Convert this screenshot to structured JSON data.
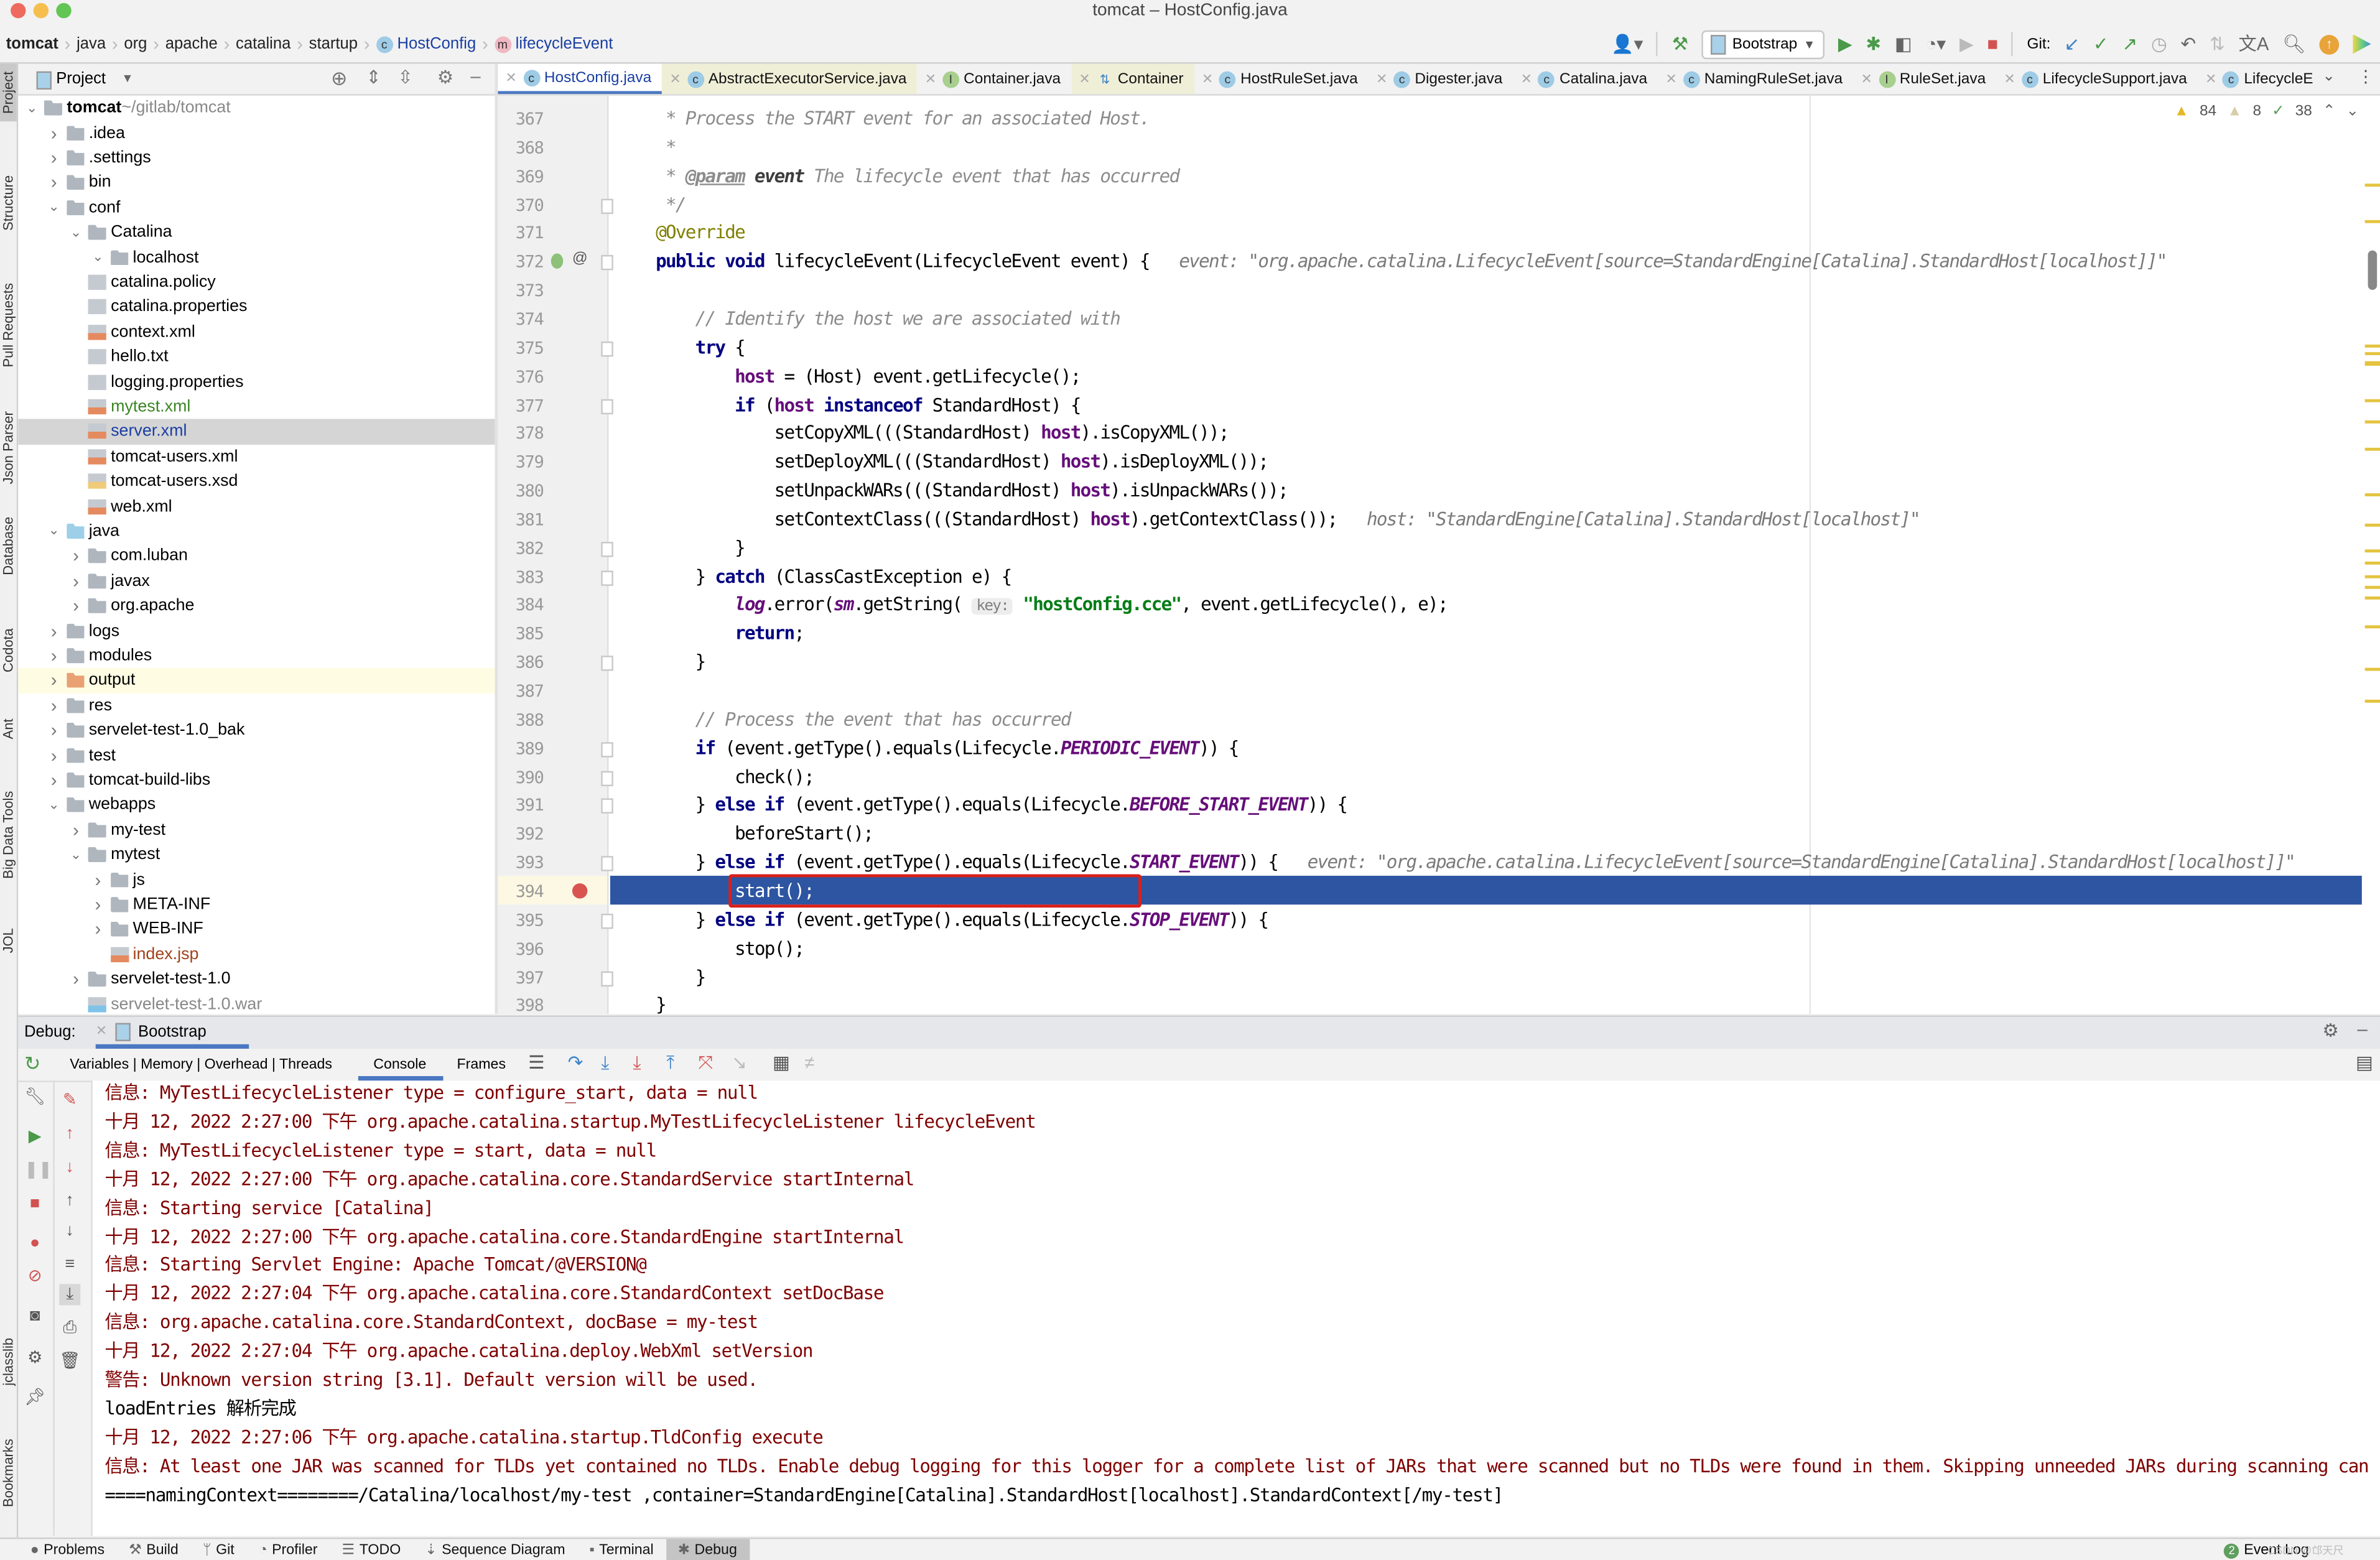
{
  "window": {
    "title": "tomcat – HostConfig.java",
    "traffic_lights": [
      "#ee6a5f",
      "#f5be4f",
      "#62c554"
    ]
  },
  "breadcrumb": [
    {
      "label": "tomcat",
      "bold": true
    },
    {
      "label": "java"
    },
    {
      "label": "org"
    },
    {
      "label": "apache"
    },
    {
      "label": "catalina"
    },
    {
      "label": "startup"
    },
    {
      "label": "HostConfig",
      "icon": "class-icon",
      "badge": "c",
      "badge_color": "#9ecbe5",
      "color": "#1a3fa3"
    },
    {
      "label": "lifecycleEvent",
      "icon": "method-icon",
      "badge": "m",
      "badge_color": "#f0b8c2",
      "color": "#1a3fa3"
    }
  ],
  "toolbar": {
    "run_config": "Bootstrap",
    "git_label": "Git:",
    "icons": [
      "user-icon",
      "build-hammer-icon",
      "run-icon",
      "debug-icon",
      "coverage-icon",
      "profile-icon",
      "stop-icon",
      "git-update-icon",
      "git-commit-icon",
      "git-push-icon",
      "history-icon",
      "rollback-icon",
      "translate-icon",
      "search-icon",
      "update-icon",
      "plugin-icon"
    ]
  },
  "project_panel": {
    "title": "Project",
    "tree": [
      {
        "label": "tomcat",
        "suffix": " ~/gitlab/tomcat",
        "level": 0,
        "expanded": true,
        "icon": "folder",
        "bold": true
      },
      {
        "label": ".idea",
        "level": 1,
        "expanded": false,
        "icon": "folder"
      },
      {
        "label": ".settings",
        "level": 1,
        "expanded": false,
        "icon": "folder"
      },
      {
        "label": "bin",
        "level": 1,
        "expanded": false,
        "icon": "folder"
      },
      {
        "label": "conf",
        "level": 1,
        "expanded": true,
        "icon": "folder"
      },
      {
        "label": "Catalina",
        "level": 2,
        "expanded": true,
        "icon": "folder"
      },
      {
        "label": "localhost",
        "level": 3,
        "expanded": true,
        "icon": "folder"
      },
      {
        "label": "catalina.policy",
        "level": 2,
        "icon": "file"
      },
      {
        "label": "catalina.properties",
        "level": 2,
        "icon": "properties"
      },
      {
        "label": "context.xml",
        "level": 2,
        "icon": "xml"
      },
      {
        "label": "hello.txt",
        "level": 2,
        "icon": "file"
      },
      {
        "label": "logging.properties",
        "level": 2,
        "icon": "properties"
      },
      {
        "label": "mytest.xml",
        "level": 2,
        "icon": "xml",
        "color": "#3b8524"
      },
      {
        "label": "server.xml",
        "level": 2,
        "icon": "xml",
        "color": "#1a3fa3",
        "selected": true
      },
      {
        "label": "tomcat-users.xml",
        "level": 2,
        "icon": "xml"
      },
      {
        "label": "tomcat-users.xsd",
        "level": 2,
        "icon": "xsd"
      },
      {
        "label": "web.xml",
        "level": 2,
        "icon": "xml"
      },
      {
        "label": "java",
        "level": 1,
        "expanded": true,
        "icon": "source-folder"
      },
      {
        "label": "com.luban",
        "level": 2,
        "expanded": false,
        "icon": "package"
      },
      {
        "label": "javax",
        "level": 2,
        "expanded": false,
        "icon": "package"
      },
      {
        "label": "org.apache",
        "level": 2,
        "expanded": false,
        "icon": "package"
      },
      {
        "label": "logs",
        "level": 1,
        "expanded": false,
        "icon": "folder"
      },
      {
        "label": "modules",
        "level": 1,
        "expanded": false,
        "icon": "folder"
      },
      {
        "label": "output",
        "level": 1,
        "expanded": false,
        "icon": "excluded-folder",
        "highlight": true
      },
      {
        "label": "res",
        "level": 1,
        "expanded": false,
        "icon": "folder"
      },
      {
        "label": "servelet-test-1.0_bak",
        "level": 1,
        "expanded": false,
        "icon": "folder"
      },
      {
        "label": "test",
        "level": 1,
        "expanded": false,
        "icon": "folder"
      },
      {
        "label": "tomcat-build-libs",
        "level": 1,
        "expanded": false,
        "icon": "folder"
      },
      {
        "label": "webapps",
        "level": 1,
        "expanded": true,
        "icon": "folder"
      },
      {
        "label": "my-test",
        "level": 2,
        "expanded": false,
        "icon": "folder"
      },
      {
        "label": "mytest",
        "level": 2,
        "expanded": true,
        "icon": "folder"
      },
      {
        "label": "js",
        "level": 3,
        "expanded": false,
        "icon": "folder"
      },
      {
        "label": "META-INF",
        "level": 3,
        "expanded": false,
        "icon": "folder"
      },
      {
        "label": "WEB-INF",
        "level": 3,
        "expanded": false,
        "icon": "folder"
      },
      {
        "label": "index.jsp",
        "level": 3,
        "icon": "jsp",
        "color": "#a0421a"
      },
      {
        "label": "servelet-test-1.0",
        "level": 2,
        "expanded": false,
        "icon": "folder"
      },
      {
        "label": "servelet-test-1.0.war",
        "level": 2,
        "icon": "archive",
        "color": "#888888"
      }
    ]
  },
  "left_tool_strip": [
    "Project",
    "Structure",
    "Pull Requests",
    "Json Parser",
    "Database",
    "Codota",
    "Ant",
    "Big Data Tools",
    "JOL",
    "jclasslib",
    "Bookmarks"
  ],
  "editor_tabs": [
    {
      "label": "HostConfig.java",
      "badge": "c",
      "active": true
    },
    {
      "label": "AbstractExecutorService.java",
      "badge": "c",
      "tint": true
    },
    {
      "label": "Container.java",
      "badge": "I"
    },
    {
      "label": "Container",
      "badge": "⇅",
      "tint": true
    },
    {
      "label": "HostRuleSet.java",
      "badge": "c"
    },
    {
      "label": "Digester.java",
      "badge": "c"
    },
    {
      "label": "Catalina.java",
      "badge": "c"
    },
    {
      "label": "NamingRuleSet.java",
      "badge": "c"
    },
    {
      "label": "RuleSet.java",
      "badge": "I"
    },
    {
      "label": "LifecycleSupport.java",
      "badge": "c"
    },
    {
      "label": "LifecycleE",
      "badge": "c"
    }
  ],
  "inspections": {
    "warnings": "84",
    "weak_warnings": "8",
    "typos": "38"
  },
  "editor": {
    "current_line": 394,
    "lines": [
      {
        "n": 367,
        "t": [
          [
            " * Process the START event for an associated Host.",
            "d"
          ]
        ]
      },
      {
        "n": 368,
        "t": [
          [
            " *",
            "d"
          ]
        ]
      },
      {
        "n": 369,
        "t": [
          [
            " * ",
            "d"
          ],
          [
            "@param",
            "dt"
          ],
          [
            " event",
            "db"
          ],
          [
            " The lifecycle event that has occurred",
            "d"
          ]
        ]
      },
      {
        "n": 370,
        "t": [
          [
            " */",
            "d"
          ]
        ]
      },
      {
        "n": 371,
        "t": [
          [
            "@Override",
            "an"
          ]
        ]
      },
      {
        "n": 372,
        "t": [
          [
            "public void",
            "k"
          ],
          [
            " lifecycleEvent(LifecycleEvent event) {",
            ""
          ],
          [
            "   event: \"org.apache.catalina.LifecycleEvent[source=StandardEngine[Catalina].StandardHost[localhost]]\"",
            "h"
          ]
        ]
      },
      {
        "n": 373,
        "t": []
      },
      {
        "n": 374,
        "t": [
          [
            "    // Identify the host we are associated with",
            "c"
          ]
        ]
      },
      {
        "n": 375,
        "t": [
          [
            "    ",
            ""
          ],
          [
            "try",
            "k"
          ],
          [
            " {",
            ""
          ]
        ]
      },
      {
        "n": 376,
        "t": [
          [
            "        ",
            ""
          ],
          [
            "host",
            "f"
          ],
          [
            " = (Host) event.getLifecycle();",
            ""
          ]
        ]
      },
      {
        "n": 377,
        "t": [
          [
            "        ",
            ""
          ],
          [
            "if",
            "k"
          ],
          [
            " (",
            ""
          ],
          [
            "host",
            "f"
          ],
          [
            " ",
            ""
          ],
          [
            "instanceof",
            "k"
          ],
          [
            " StandardHost) {",
            ""
          ]
        ]
      },
      {
        "n": 378,
        "t": [
          [
            "            setCopyXML(((StandardHost) ",
            ""
          ],
          [
            "host",
            "f"
          ],
          [
            ").isCopyXML());",
            ""
          ]
        ]
      },
      {
        "n": 379,
        "t": [
          [
            "            setDeployXML(((StandardHost) ",
            ""
          ],
          [
            "host",
            "f"
          ],
          [
            ").isDeployXML());",
            ""
          ]
        ]
      },
      {
        "n": 380,
        "t": [
          [
            "            setUnpackWARs(((StandardHost) ",
            ""
          ],
          [
            "host",
            "f"
          ],
          [
            ").isUnpackWARs());",
            ""
          ]
        ]
      },
      {
        "n": 381,
        "t": [
          [
            "            setContextClass(((StandardHost) ",
            ""
          ],
          [
            "host",
            "f"
          ],
          [
            ").getContextClass());",
            ""
          ],
          [
            "   host: \"StandardEngine[Catalina].StandardHost[localhost]\"",
            "h"
          ]
        ]
      },
      {
        "n": 382,
        "t": [
          [
            "        }",
            ""
          ]
        ]
      },
      {
        "n": 383,
        "t": [
          [
            "    } ",
            ""
          ],
          [
            "catch",
            "k"
          ],
          [
            " (ClassCastException e) {",
            ""
          ]
        ]
      },
      {
        "n": 384,
        "t": [
          [
            "        ",
            ""
          ],
          [
            "log",
            "lg"
          ],
          [
            ".error(",
            ""
          ],
          [
            "sm",
            "lg"
          ],
          [
            ".getString( ",
            ""
          ],
          [
            "key:",
            "p"
          ],
          [
            " ",
            ""
          ],
          [
            "\"hostConfig.cce\"",
            "s"
          ],
          [
            ", event.getLifecycle(), e);",
            ""
          ]
        ]
      },
      {
        "n": 385,
        "t": [
          [
            "        ",
            ""
          ],
          [
            "return",
            "k"
          ],
          [
            ";",
            ""
          ]
        ]
      },
      {
        "n": 386,
        "t": [
          [
            "    }",
            ""
          ]
        ]
      },
      {
        "n": 387,
        "t": []
      },
      {
        "n": 388,
        "t": [
          [
            "    // Process the event that has occurred",
            "c"
          ]
        ]
      },
      {
        "n": 389,
        "t": [
          [
            "    ",
            ""
          ],
          [
            "if",
            "k"
          ],
          [
            " (event.getType().equals(Lifecycle.",
            ""
          ],
          [
            "PERIODIC_EVENT",
            "st"
          ],
          [
            ")) {",
            ""
          ]
        ]
      },
      {
        "n": 390,
        "t": [
          [
            "        check();",
            ""
          ]
        ]
      },
      {
        "n": 391,
        "t": [
          [
            "    } ",
            ""
          ],
          [
            "else if",
            "k"
          ],
          [
            " (event.getType().equals(Lifecycle.",
            ""
          ],
          [
            "BEFORE_START_EVENT",
            "st"
          ],
          [
            ")) {",
            ""
          ]
        ]
      },
      {
        "n": 392,
        "t": [
          [
            "        beforeStart();",
            ""
          ]
        ]
      },
      {
        "n": 393,
        "t": [
          [
            "    } ",
            ""
          ],
          [
            "else if",
            "k"
          ],
          [
            " (event.getType().equals(Lifecycle.",
            ""
          ],
          [
            "START_EVENT",
            "st"
          ],
          [
            ")) {",
            ""
          ],
          [
            "   event: \"org.apache.catalina.LifecycleEvent[source=StandardEngine[Catalina].StandardHost[localhost]]\"",
            "h"
          ]
        ]
      },
      {
        "n": 394,
        "t": [
          [
            "        start();",
            ""
          ]
        ]
      },
      {
        "n": 395,
        "t": [
          [
            "    } ",
            ""
          ],
          [
            "else if",
            "k"
          ],
          [
            " (event.getType().equals(Lifecycle.",
            ""
          ],
          [
            "STOP_EVENT",
            "st"
          ],
          [
            ")) {",
            ""
          ]
        ]
      },
      {
        "n": 396,
        "t": [
          [
            "        stop();",
            ""
          ]
        ]
      },
      {
        "n": 397,
        "t": [
          [
            "    }",
            ""
          ]
        ]
      },
      {
        "n": 398,
        "t": [
          [
            "}",
            ""
          ]
        ]
      }
    ]
  },
  "debug": {
    "label": "Debug:",
    "session": "Bootstrap",
    "tabs": {
      "variables_group": "Variables | Memory | Overhead | Threads",
      "console": "Console",
      "frames": "Frames"
    },
    "active_tab": "Console",
    "console_lines": [
      {
        "text": "信息: MyTestLifecycleListener type = configure_start, data = null",
        "color": "#7f0000"
      },
      {
        "text": "十月 12, 2022 2:27:00 下午 org.apache.catalina.startup.MyTestLifecycleListener lifecycleEvent",
        "color": "#7f0000"
      },
      {
        "text": "信息: MyTestLifecycleListener type = start, data = null",
        "color": "#7f0000"
      },
      {
        "text": "十月 12, 2022 2:27:00 下午 org.apache.catalina.core.StandardService startInternal",
        "color": "#7f0000"
      },
      {
        "text": "信息: Starting service [Catalina]",
        "color": "#7f0000"
      },
      {
        "text": "十月 12, 2022 2:27:00 下午 org.apache.catalina.core.StandardEngine startInternal",
        "color": "#7f0000"
      },
      {
        "text": "信息: Starting Servlet Engine: Apache Tomcat/@VERSION@",
        "color": "#7f0000"
      },
      {
        "text": "十月 12, 2022 2:27:04 下午 org.apache.catalina.core.StandardContext setDocBase",
        "color": "#7f0000"
      },
      {
        "text": "信息: org.apache.catalina.core.StandardContext, docBase = my-test",
        "color": "#7f0000"
      },
      {
        "text": "十月 12, 2022 2:27:04 下午 org.apache.catalina.deploy.WebXml setVersion",
        "color": "#7f0000"
      },
      {
        "text": "警告: Unknown version string [3.1]. Default version will be used.",
        "color": "#7f0000"
      },
      {
        "text": "loadEntries 解析完成",
        "color": "#000000"
      },
      {
        "text": "十月 12, 2022 2:27:06 下午 org.apache.catalina.startup.TldConfig execute",
        "color": "#7f0000"
      },
      {
        "text": "信息: At least one JAR was scanned for TLDs yet contained no TLDs. Enable debug logging for this logger for a complete list of JARs that were scanned but no TLDs were found in them. Skipping unneeded JARs during scanning can impr",
        "color": "#7f0000"
      },
      {
        "text": "====namingContext========/Catalina/localhost/my-test ,container=StandardEngine[Catalina].StandardHost[localhost].StandardContext[/my-test]",
        "color": "#000000"
      }
    ]
  },
  "status_bar": {
    "items": [
      {
        "label": "Problems",
        "icon": "●"
      },
      {
        "label": "Build",
        "icon": "⚒"
      },
      {
        "label": "Git",
        "icon": "ᛘ"
      },
      {
        "label": "Profiler",
        "icon": "◔"
      },
      {
        "label": "TODO",
        "icon": "☰"
      },
      {
        "label": "Sequence Diagram",
        "icon": "⇣"
      },
      {
        "label": "Terminal",
        "icon": "▪"
      },
      {
        "label": "Debug",
        "icon": "✱",
        "active": true
      }
    ],
    "event_log": {
      "count": "2",
      "label": "Event Log"
    },
    "watermark": "CSDN @邙天尺"
  },
  "colors": {
    "selection": "#2e55a1",
    "breakpoint": "#d9534f",
    "highlight_box": "#d9201a",
    "active_tab_underline": "#4a78c2"
  }
}
